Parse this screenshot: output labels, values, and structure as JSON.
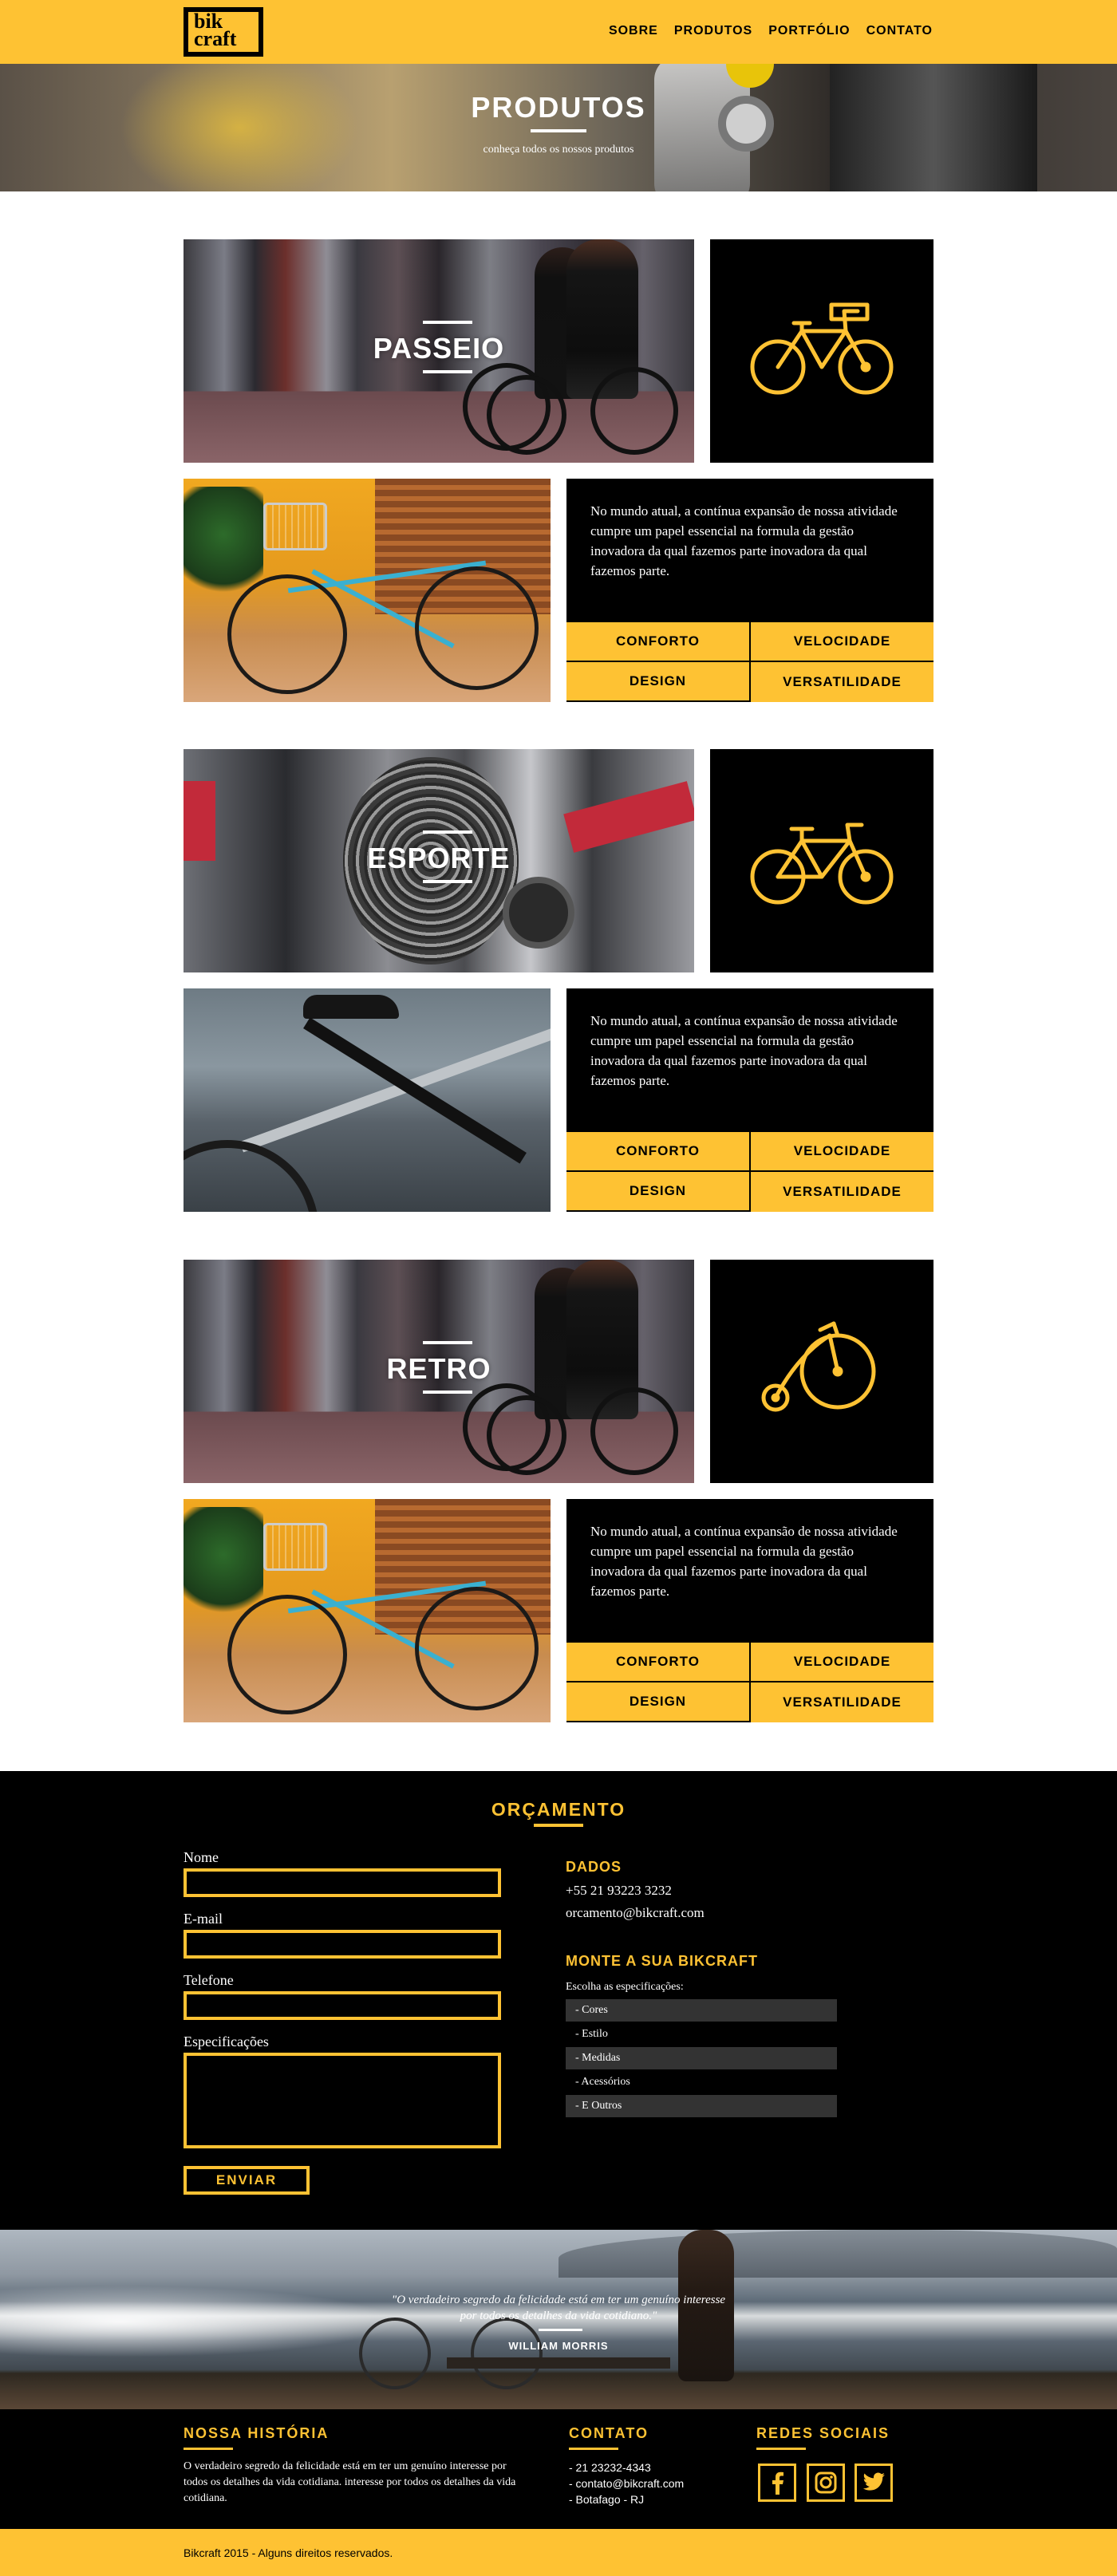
{
  "brand": {
    "logo_line1": "bik",
    "logo_line2": "craft",
    "accent": "#FEC233"
  },
  "nav": [
    "SOBRE",
    "PRODUTOS",
    "PORTFÓLIO",
    "CONTATO"
  ],
  "hero": {
    "title": "PRODUTOS",
    "subtitle": "conheça todos os nossos produtos"
  },
  "products": [
    {
      "name": "PASSEIO",
      "icon": "city-bike-icon",
      "description": "No mundo atual, a contínua expansão de nossa atividade cumpre um papel essencial na formula da gestão inovadora da qual fazemos parte inovadora da qual fazemos parte.",
      "features": [
        "CONFORTO",
        "VELOCIDADE",
        "DESIGN",
        "VERSATILIDADE"
      ]
    },
    {
      "name": "ESPORTE",
      "icon": "sport-bike-icon",
      "description": "No mundo atual, a contínua expansão de nossa atividade cumpre um papel essencial na formula da gestão inovadora da qual fazemos parte inovadora da qual fazemos parte.",
      "features": [
        "CONFORTO",
        "VELOCIDADE",
        "DESIGN",
        "VERSATILIDADE"
      ]
    },
    {
      "name": "RETRO",
      "icon": "penny-farthing-icon",
      "description": "No mundo atual, a contínua expansão de nossa atividade cumpre um papel essencial na formula da gestão inovadora da qual fazemos parte inovadora da qual fazemos parte.",
      "features": [
        "CONFORTO",
        "VELOCIDADE",
        "DESIGN",
        "VERSATILIDADE"
      ]
    }
  ],
  "orcamento": {
    "title": "ORÇAMENTO",
    "fields": {
      "nome": "Nome",
      "email": "E-mail",
      "telefone": "Telefone",
      "especificacoes": "Especificações"
    },
    "submit": "ENVIAR",
    "dados_title": "DADOS",
    "phone": "+55 21 93223 3232",
    "email": "orcamento@bikcraft.com",
    "monte_title": "MONTE A SUA BIKCRAFT",
    "spec_label": "Escolha as especificações:",
    "spec_items": [
      "- Cores",
      "- Estilo",
      "- Medidas",
      "- Acessórios",
      "- E Outros"
    ]
  },
  "quote": {
    "text": "\"O verdadeiro segredo da felicidade está em ter um genuíno interesse por todos os detalhes da vida cotidiano.\"",
    "author": "WILLIAM MORRIS"
  },
  "footer": {
    "historia_title": "NOSSA HISTÓRIA",
    "historia_text": "O verdadeiro segredo da felicidade está em ter um genuíno interesse por todos os detalhes da vida cotidiana. interesse por todos os detalhes da vida cotidiana.",
    "contato_title": "CONTATO",
    "contato_items": [
      "- 21 23232-4343",
      "- contato@bikcraft.com",
      "- Botafago - RJ"
    ],
    "redes_title": "REDES SOCIAIS",
    "socials": [
      "facebook-icon",
      "instagram-icon",
      "twitter-icon"
    ],
    "copyright": "Bikcraft 2015 - Alguns direitos reservados."
  }
}
